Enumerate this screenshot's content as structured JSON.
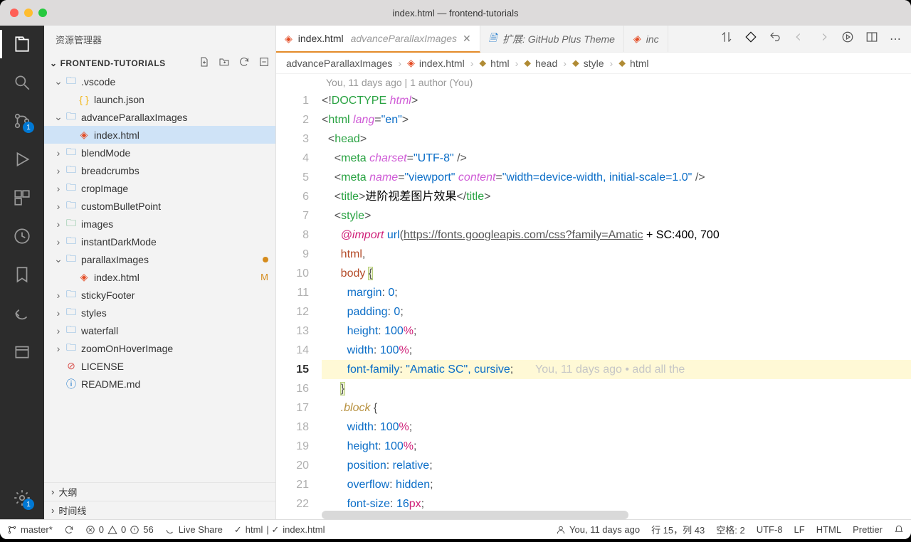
{
  "window": {
    "title": "index.html — frontend-tutorials"
  },
  "sidebar": {
    "title": "资源管理器",
    "project": "FRONTEND-TUTORIALS",
    "tree": [
      {
        "depth": 1,
        "type": "folder",
        "open": true,
        "name": ".vscode"
      },
      {
        "depth": 2,
        "type": "json",
        "name": "launch.json"
      },
      {
        "depth": 1,
        "type": "folder",
        "open": true,
        "name": "advanceParallaxImages"
      },
      {
        "depth": 2,
        "type": "html",
        "name": "index.html",
        "selected": true
      },
      {
        "depth": 1,
        "type": "folder",
        "name": "blendMode"
      },
      {
        "depth": 1,
        "type": "folder",
        "name": "breadcrumbs"
      },
      {
        "depth": 1,
        "type": "folder",
        "name": "cropImage"
      },
      {
        "depth": 1,
        "type": "folder",
        "name": "customBulletPoint"
      },
      {
        "depth": 1,
        "type": "folderimg",
        "name": "images"
      },
      {
        "depth": 1,
        "type": "folder",
        "name": "instantDarkMode"
      },
      {
        "depth": 1,
        "type": "folder",
        "open": true,
        "name": "parallaxImages",
        "dot": true
      },
      {
        "depth": 2,
        "type": "html",
        "name": "index.html",
        "mod": "M"
      },
      {
        "depth": 1,
        "type": "folder",
        "name": "stickyFooter"
      },
      {
        "depth": 1,
        "type": "folder",
        "name": "styles"
      },
      {
        "depth": 1,
        "type": "folder",
        "name": "waterfall"
      },
      {
        "depth": 1,
        "type": "folder",
        "name": "zoomOnHoverImage"
      },
      {
        "depth": 1,
        "type": "license",
        "name": "LICENSE"
      },
      {
        "depth": 1,
        "type": "readme",
        "name": "README.md"
      }
    ],
    "sections": {
      "outline": "大纲",
      "timeline": "时间线"
    }
  },
  "activity_badge": {
    "scm": "1",
    "settings": "1"
  },
  "tabs": {
    "tab1": {
      "name": "index.html",
      "sub": "advanceParallaxImages"
    },
    "tab2": {
      "name": "扩展: GitHub Plus Theme"
    },
    "tab3": {
      "name": "inc"
    }
  },
  "breadcrumbs": [
    "advanceParallaxImages",
    "index.html",
    "html",
    "head",
    "style",
    "html"
  ],
  "codelens": "You, 11 days ago | 1 author (You)",
  "blame": "You, 11 days ago • add all the",
  "code": {
    "title_text": "进阶视差图片效果",
    "import_url": "https://fonts.googleapis.com/css?family=Amatic",
    "import_tail": " + SC:400, 700",
    "font_family": "\"Amatic SC\", cursive"
  },
  "status": {
    "branch": "master*",
    "errors": "0",
    "warnings": "0",
    "info": "56",
    "liveshare": "Live Share",
    "lang_chk": "html",
    "file_chk": "index.html",
    "blame": "You, 11 days ago",
    "pos": "行 15，列 43",
    "spaces": "空格: 2",
    "encoding": "UTF-8",
    "eol": "LF",
    "mode": "HTML",
    "prettier": "Prettier"
  }
}
